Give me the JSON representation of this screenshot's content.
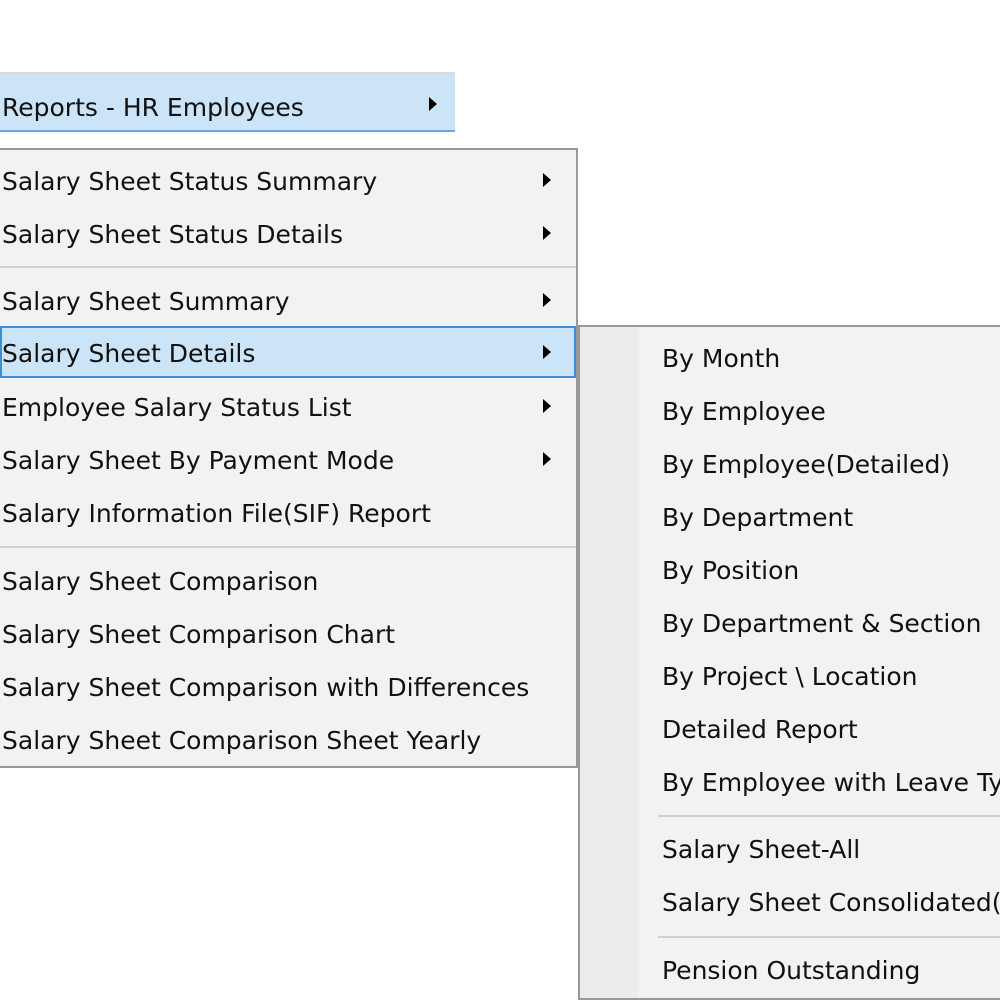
{
  "parent_menu_item": {
    "label": "Reports - HR Employees"
  },
  "menu": {
    "groups": [
      {
        "items": [
          {
            "label": "Salary Sheet Status Summary",
            "has_submenu": true
          },
          {
            "label": "Salary Sheet Status Details",
            "has_submenu": true
          }
        ]
      },
      {
        "items": [
          {
            "label": "Salary Sheet Summary",
            "has_submenu": true
          },
          {
            "label": "Salary Sheet Details",
            "has_submenu": true,
            "selected": true
          },
          {
            "label": "Employee Salary Status List",
            "has_submenu": true
          },
          {
            "label": "Salary Sheet By Payment Mode",
            "has_submenu": true
          },
          {
            "label": "Salary Information File(SIF) Report",
            "has_submenu": false
          }
        ]
      },
      {
        "items": [
          {
            "label": "Salary Sheet Comparison",
            "has_submenu": false
          },
          {
            "label": "Salary Sheet Comparison Chart",
            "has_submenu": false
          },
          {
            "label": "Salary Sheet Comparison with Differences",
            "has_submenu": false
          },
          {
            "label": "Salary Sheet Comparison Sheet Yearly",
            "has_submenu": false
          }
        ]
      }
    ]
  },
  "submenu": {
    "parent": "Salary Sheet Details",
    "groups": [
      {
        "items": [
          {
            "label": "By Month"
          },
          {
            "label": "By Employee"
          },
          {
            "label": "By Employee(Detailed)"
          },
          {
            "label": "By Department"
          },
          {
            "label": "By Position"
          },
          {
            "label": "By Department & Section"
          },
          {
            "label": "By Project \\ Location"
          },
          {
            "label": "Detailed Report"
          },
          {
            "label": "By Employee with Leave Type"
          }
        ]
      },
      {
        "items": [
          {
            "label": "Salary Sheet-All"
          },
          {
            "label": "Salary Sheet Consolidated(St"
          }
        ]
      },
      {
        "items": [
          {
            "label": "Pension Outstanding"
          }
        ]
      }
    ]
  },
  "colors": {
    "highlight_bg": "#cce4f7",
    "highlight_border": "#3d8ed8",
    "menu_bg": "#f2f2f2",
    "menu_border": "#999999",
    "separator": "#d0d0d0"
  }
}
